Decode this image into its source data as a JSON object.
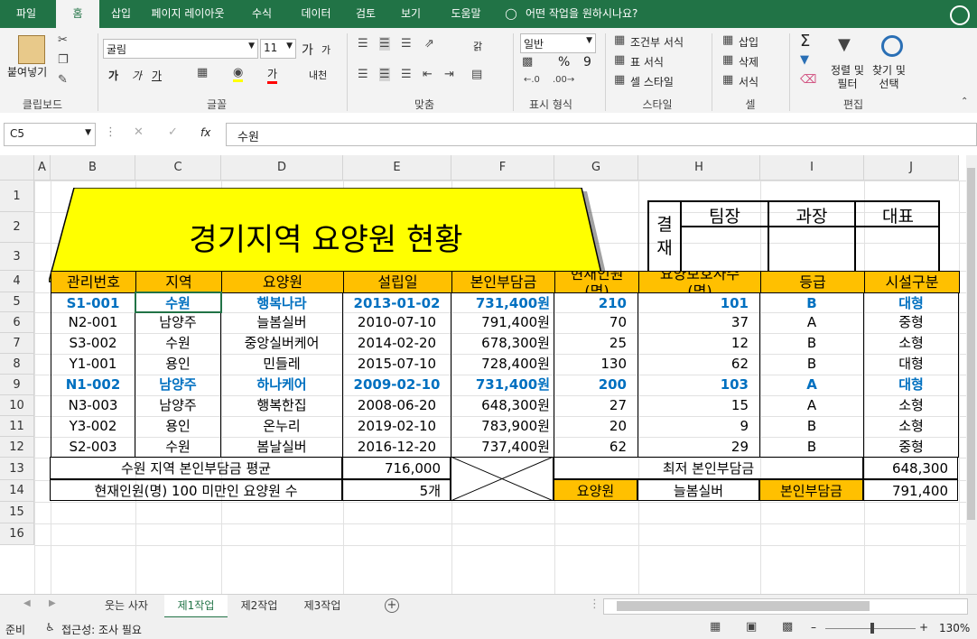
{
  "ribbon_tabs": [
    "파일",
    "홈",
    "삽입",
    "페이지 레이아웃",
    "수식",
    "데이터",
    "검토",
    "보기",
    "도움말"
  ],
  "tell_me": "어떤 작업을 원하시나요?",
  "clipboard": {
    "paste": "붙여넣기",
    "label": "클립보드"
  },
  "font": {
    "name": "굴림",
    "size": "11",
    "label": "글꼴",
    "bold": "가",
    "italic": "가",
    "underline": "가",
    "grow": "가",
    "shrink": "가",
    "color_glyph": "가",
    "phonetic": "내천"
  },
  "align": {
    "label": "맞춤",
    "wrap": "갉"
  },
  "number": {
    "format": "일반",
    "label": "표시 형식",
    "percent": "%",
    "comma": "9"
  },
  "styles": {
    "cond": "조건부 서식",
    "table": "표 서식",
    "cell": "셀 스타일",
    "label": "스타일"
  },
  "cells": {
    "insert": "삽입",
    "delete": "삭제",
    "format": "서식",
    "label": "셀"
  },
  "editing": {
    "sort": "정렬 및\n필터",
    "find": "찾기 및\n선택",
    "label": "편집",
    "sigma": "Σ"
  },
  "formula_bar": {
    "name_box": "C5",
    "fx": "fx",
    "content": "수원"
  },
  "columns": [
    "A",
    "B",
    "C",
    "D",
    "E",
    "F",
    "G",
    "H",
    "I",
    "J"
  ],
  "rows": [
    "1",
    "2",
    "3",
    "4",
    "5",
    "6",
    "7",
    "8",
    "9",
    "10",
    "11",
    "12",
    "13",
    "14",
    "15",
    "16"
  ],
  "title_shape": "경기지역 요양원 현황",
  "approval": {
    "side": "결\n재",
    "cols": [
      "팀장",
      "과장",
      "대표"
    ]
  },
  "table": {
    "headers": [
      "관리번호",
      "지역",
      "요양원",
      "설립일",
      "본인부담금",
      "현재인원\n(명)",
      "요양보호사수\n(명)",
      "등급",
      "시설구분"
    ],
    "rows": [
      [
        "S1-001",
        "수원",
        "행복나라",
        "2013-01-02",
        "731,400원",
        "210",
        "101",
        "B",
        "대형"
      ],
      [
        "N2-001",
        "남양주",
        "늘봄실버",
        "2010-07-10",
        "791,400원",
        "70",
        "37",
        "A",
        "중형"
      ],
      [
        "S3-002",
        "수원",
        "중앙실버케어",
        "2014-02-20",
        "678,300원",
        "25",
        "12",
        "B",
        "소형"
      ],
      [
        "Y1-001",
        "용인",
        "민들레",
        "2015-07-10",
        "728,400원",
        "130",
        "62",
        "B",
        "대형"
      ],
      [
        "N1-002",
        "남양주",
        "하나케어",
        "2009-02-10",
        "731,400원",
        "200",
        "103",
        "A",
        "대형"
      ],
      [
        "N3-003",
        "남양주",
        "행복한집",
        "2008-06-20",
        "648,300원",
        "27",
        "15",
        "A",
        "소형"
      ],
      [
        "Y3-002",
        "용인",
        "온누리",
        "2019-02-10",
        "783,900원",
        "20",
        "9",
        "B",
        "소형"
      ],
      [
        "S2-003",
        "수원",
        "봄날실버",
        "2016-12-20",
        "737,400원",
        "62",
        "29",
        "B",
        "중형"
      ]
    ],
    "highlight_rows": [
      0,
      4
    ]
  },
  "summary": {
    "r13_label": "수원 지역 본인부담금 평균",
    "r13_value": "716,000",
    "r13_right_label": "최저 본인부담금",
    "r13_right_value": "648,300",
    "r14_label": "현재인원(명) 100 미만인 요양원 수",
    "r14_value": "5개",
    "r14_g": "요양원",
    "r14_h": "늘봄실버",
    "r14_i": "본인부담금",
    "r14_j": "791,400"
  },
  "sheets": [
    "웃는 사자",
    "제1작업",
    "제2작업",
    "제3작업"
  ],
  "active_sheet": "제1작업",
  "status": {
    "ready": "준비",
    "accessibility": "접근성: 조사 필요",
    "zoom": "130%"
  },
  "colors": {
    "excel_green": "#217346",
    "header_orange": "#ffc000",
    "title_yellow": "#ffff00",
    "blue_text": "#0070c0"
  }
}
